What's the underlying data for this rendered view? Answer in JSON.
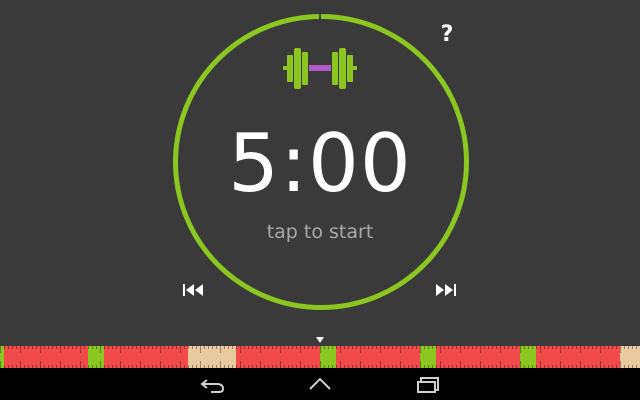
{
  "timer": {
    "display": "5:00",
    "hint": "tap to start"
  },
  "help": {
    "label": "?"
  },
  "colors": {
    "background": "#3a3a3a",
    "ring": "#8bc621",
    "dumbbell_plates": "#8bc621",
    "dumbbell_bar": "#b25cc8",
    "ruler_red": "#f04a4a",
    "ruler_green": "#8bc621",
    "ruler_tan": "#e8c9a0"
  },
  "icons": {
    "logo": "dumbbell-icon",
    "previous": "skip-previous-icon",
    "next": "skip-next-icon",
    "marker": "triangle-down-icon",
    "nav_back": "back-icon",
    "nav_home": "home-icon",
    "nav_recents": "recents-icon"
  }
}
